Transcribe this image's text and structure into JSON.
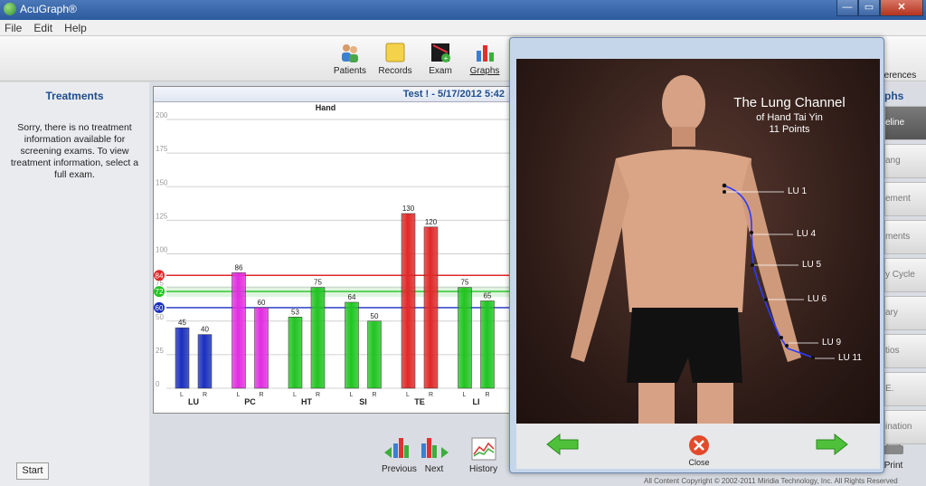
{
  "window": {
    "title": "AcuGraph®"
  },
  "menu": [
    "File",
    "Edit",
    "Help"
  ],
  "toolbar": {
    "patients": "Patients",
    "records": "Records",
    "exam": "Exam",
    "graphs": "Graphs",
    "preferences": "references"
  },
  "treatments": {
    "title": "Treatments",
    "message": "Sorry, there is no treatment information available for screening exams.  To view treatment information, select a full exam."
  },
  "start_label": "Start",
  "chart_header": "Test ! - 5/17/2012 5:42",
  "chart_data": {
    "type": "bar",
    "title": "Hand",
    "ylim": [
      0,
      200
    ],
    "yticks": [
      0,
      25,
      50,
      75,
      100,
      125,
      150,
      175,
      200
    ],
    "groups": [
      "LU",
      "PC",
      "HT",
      "SI",
      "TE",
      "LI"
    ],
    "sides": [
      "L",
      "R"
    ],
    "series": [
      {
        "group": "LU",
        "color": "#1a2fbf",
        "values": [
          45,
          40
        ]
      },
      {
        "group": "PC",
        "color": "#e02ee0",
        "values": [
          86,
          60
        ]
      },
      {
        "group": "HT",
        "color": "#22c422",
        "values": [
          53,
          75
        ]
      },
      {
        "group": "SI",
        "color": "#22c422",
        "values": [
          64,
          50
        ]
      },
      {
        "group": "TE",
        "color": "#e02828",
        "values": [
          130,
          120
        ]
      },
      {
        "group": "LI",
        "color": "#22c422",
        "values": [
          75,
          65
        ]
      }
    ],
    "reference_lines": [
      {
        "value": 84,
        "label": "84",
        "color": "#e02828"
      },
      {
        "value": 72,
        "label": "72",
        "color": "#22c422"
      },
      {
        "value": 60,
        "label": "60",
        "color": "#1a2fbf"
      }
    ],
    "green_band": [
      68,
      76
    ]
  },
  "nav": {
    "previous": "Previous",
    "next": "Next",
    "history": "History",
    "print": "Print"
  },
  "copyright": "All Content Copyright © 2002-2011 Miridia Technology, Inc.  All Rights Reserved",
  "rightside": {
    "header": "phs",
    "items": [
      "eline",
      "ang",
      "ement",
      "ments",
      "y Cycle",
      "ary",
      "tios",
      "E.",
      "ination"
    ]
  },
  "popup": {
    "title": "The Lung Channel",
    "subtitle": "of Hand Tai Yin",
    "points": "11 Points",
    "labels": [
      "LU 1",
      "LU 4",
      "LU 5",
      "LU 6",
      "LU 9",
      "LU 11"
    ],
    "close": "Close"
  }
}
